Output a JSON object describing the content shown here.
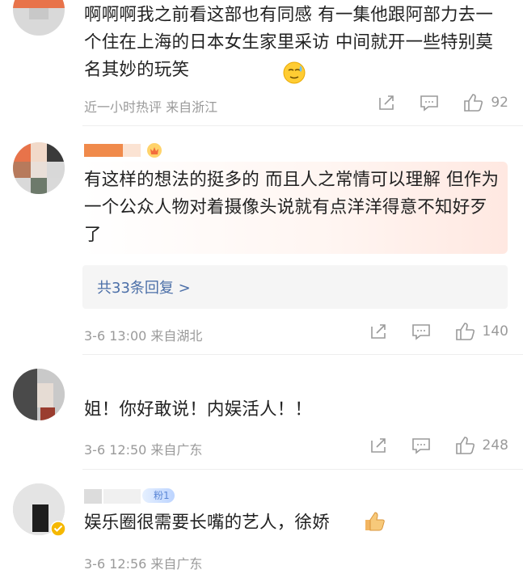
{
  "comments": [
    {
      "text": "啊啊啊我之前看这部也有同感 有一集他跟阿部力去一个住在上海的日本女生家里采访 中间就开一些特别莫名其妙的玩笑",
      "emoji": "sweat-smile-emoji",
      "meta": "近一小时热评  来自浙江",
      "likes": "92"
    },
    {
      "text": "有这样的想法的挺多的 而且人之常情可以理解 但作为一个公众人物对着摄像头说就有点洋洋得意不知好歹了",
      "replies_label": "共33条回复 >",
      "meta": "3-6 13:00  来自湖北",
      "likes": "140"
    },
    {
      "text": "姐！你好敢说！内娱活人！！",
      "meta": "3-6 12:50  来自广东",
      "likes": "248"
    },
    {
      "text": "娱乐圈很需要长嘴的艺人，徐娇",
      "emoji": "thumbs-up-emoji",
      "badge": "粉1",
      "meta": "3-6 12:56  来自广东"
    }
  ],
  "colors": {
    "meta_gray": "#9a9a9a",
    "link_blue": "#4b6fa8",
    "verified_badge": "#f5b800",
    "divider": "#eeeeee"
  },
  "icons": [
    "share-icon",
    "comment-icon",
    "like-icon"
  ]
}
